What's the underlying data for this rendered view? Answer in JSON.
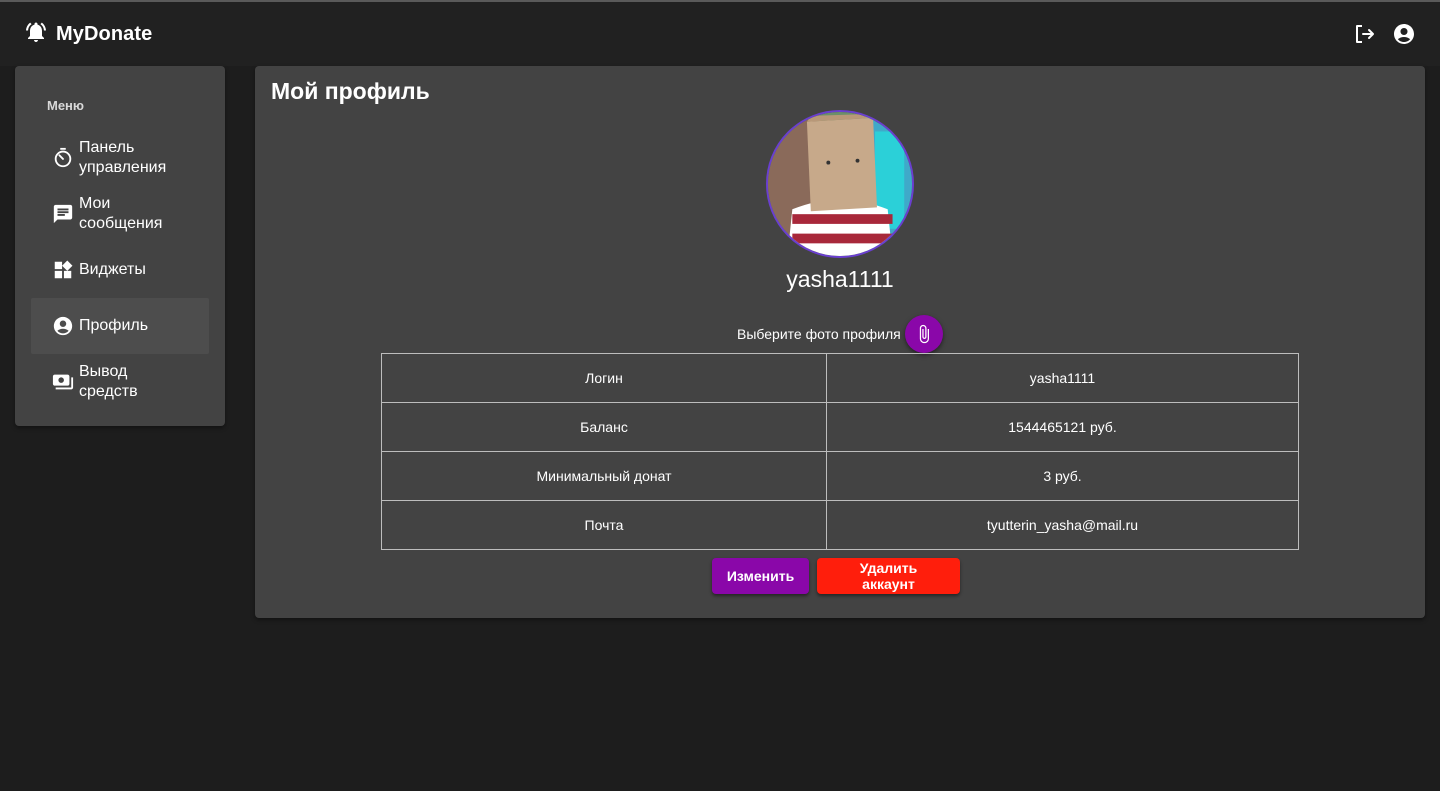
{
  "app": {
    "title": "MyDonate"
  },
  "header": {
    "logout_icon": "logout-icon",
    "account_icon": "account-circle-icon"
  },
  "sidebar": {
    "title": "Меню",
    "items": [
      {
        "label": "Панель управления",
        "icon": "timer-icon",
        "active": false
      },
      {
        "label": "Мои сообщения",
        "icon": "message-icon",
        "active": false
      },
      {
        "label": "Виджеты",
        "icon": "widgets-icon",
        "active": false
      },
      {
        "label": "Профиль",
        "icon": "account-circle-icon",
        "active": true
      },
      {
        "label": "Вывод средств",
        "icon": "money-icon",
        "active": false
      }
    ]
  },
  "profile": {
    "title": "Мой профиль",
    "username": "yasha1111",
    "choose_photo_label": "Выберите фото профиля",
    "rows": [
      {
        "key": "Логин",
        "value": "yasha1111"
      },
      {
        "key": "Баланс",
        "value": "1544465121 руб."
      },
      {
        "key": "Минимальный донат",
        "value": "3 руб."
      },
      {
        "key": "Почта",
        "value": "tyutterin_yasha@mail.ru"
      }
    ],
    "edit_label": "Изменить",
    "delete_label": "Удалить аккаунт"
  },
  "colors": {
    "accent": "#8a07a9",
    "danger": "#ff1e0c",
    "card": "#434343",
    "background": "#1d1d1d"
  }
}
